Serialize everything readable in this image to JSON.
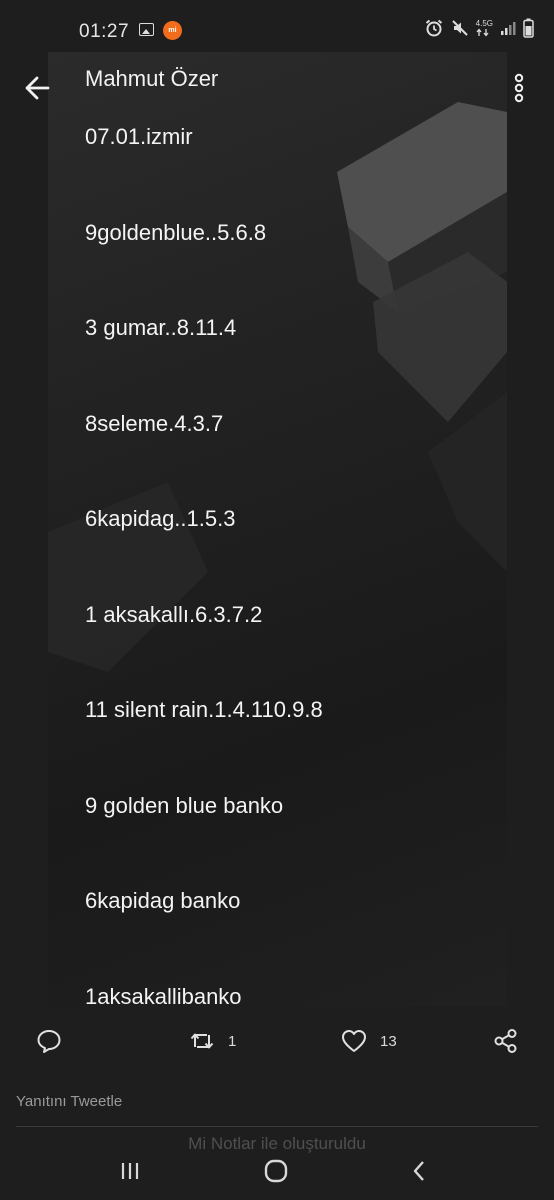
{
  "status_bar": {
    "time": "01:27",
    "network": "4.5G",
    "icons": [
      "gallery-icon",
      "mi-notes-icon",
      "alarm-icon",
      "mute-icon",
      "signal-icon",
      "battery-icon"
    ]
  },
  "media": {
    "title": "Mahmut Özer",
    "lines": [
      "07.01.izmir",
      "9goldenblue..5.6.8",
      "3 gumar..8.11.4",
      "8seleme.4.3.7",
      "6kapidag..1.5.3",
      "1 aksakallı.6.3.7.2",
      "11 silent rain.1.4.110.9.8",
      "9 golden blue banko",
      "6kapidag banko",
      "1aksakallibanko"
    ]
  },
  "actions": {
    "retweets": "1",
    "likes": "13"
  },
  "reply": {
    "placeholder": "Yanıtını Tweetle",
    "watermark": "Mi Notlar ile oluşturuldu"
  },
  "colors": {
    "background": "#1e1e1e",
    "text": "#f4f4f4",
    "muted": "#9a9a9a",
    "mi_orange": "#f26c1c"
  }
}
